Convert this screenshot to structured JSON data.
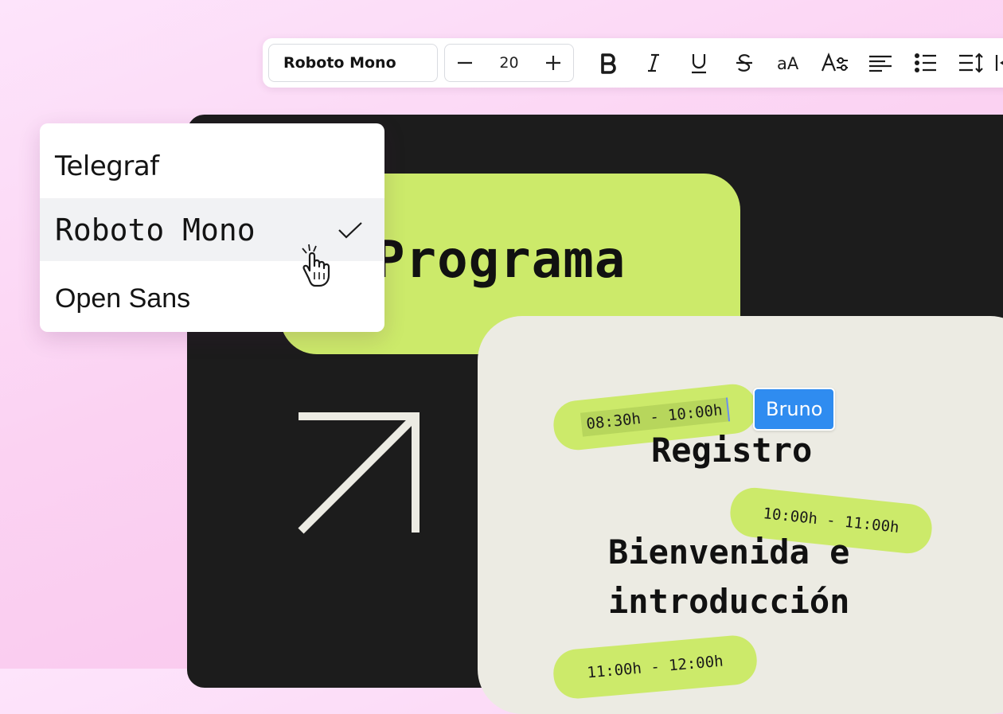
{
  "toolbar": {
    "font_value": "Roboto Mono",
    "font_size": "20",
    "tools": [
      {
        "name": "bold-icon"
      },
      {
        "name": "italic-icon"
      },
      {
        "name": "underline-icon"
      },
      {
        "name": "strikethrough-icon"
      },
      {
        "name": "letter-case-icon"
      },
      {
        "name": "text-effects-icon"
      },
      {
        "name": "align-left-icon"
      },
      {
        "name": "bullet-list-icon"
      },
      {
        "name": "line-spacing-icon"
      },
      {
        "name": "indent-icon"
      }
    ],
    "case_glyph": "aA"
  },
  "font_dropdown": {
    "options": [
      {
        "label": "Telegraf",
        "selected": false
      },
      {
        "label": "Roboto Mono",
        "selected": true
      },
      {
        "label": "Open Sans",
        "selected": false
      }
    ]
  },
  "canvas": {
    "title": "Programa",
    "schedule": [
      {
        "time": "08:30h - 10:00h",
        "title": "Registro"
      },
      {
        "time": "10:00h - 11:00h",
        "title_lines": [
          "Bienvenida e",
          "introducción"
        ]
      },
      {
        "time": "11:00h - 12:00h"
      }
    ],
    "collaborator": "Bruno"
  },
  "colors": {
    "accent_green": "#ccea6a",
    "canvas_dark": "#1c1c1c",
    "card_beige": "#ecebe3",
    "collab_blue": "#2f8cf0",
    "background_pink": "#fbd2f2"
  }
}
